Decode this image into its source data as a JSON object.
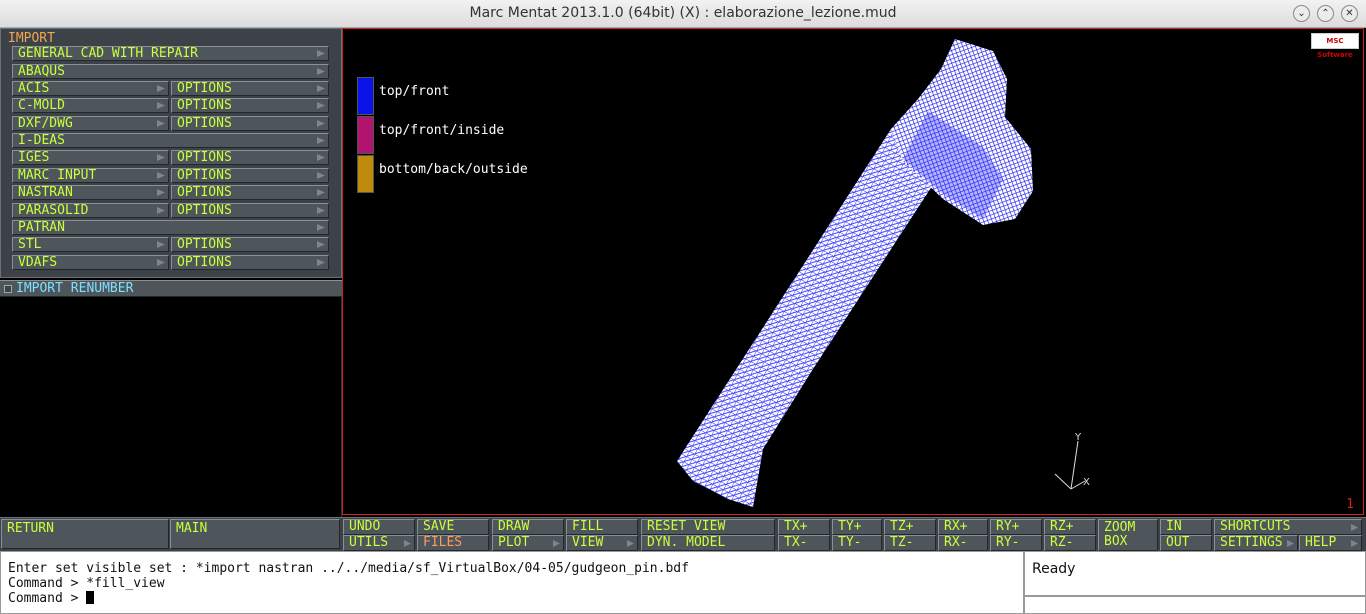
{
  "window": {
    "title": "Marc Mentat 2013.1.0 (64bit) (X) : elaborazione_lezione.mud",
    "controls": [
      "⌄",
      "⌃",
      "✕"
    ]
  },
  "import_menu": {
    "title": "IMPORT",
    "general_cad": "GENERAL CAD WITH REPAIR",
    "abaqus": "ABAQUS",
    "acis": "ACIS",
    "cmold": "C-MOLD",
    "dxf": "DXF/DWG",
    "ideas": "I-DEAS",
    "iges": "IGES",
    "marc_input": "MARC INPUT",
    "nastran": "NASTRAN",
    "parasolid": "PARASOLID",
    "patran": "PATRAN",
    "stl": "STL",
    "vdafs": "VDAFS",
    "options": "OPTIONS"
  },
  "renumber": {
    "label": "IMPORT RENUMBER"
  },
  "nav": {
    "return": "RETURN",
    "main": "MAIN"
  },
  "viewport": {
    "logo": "MSC Software",
    "legend": [
      {
        "label": "top/front",
        "color": "#0a14e6"
      },
      {
        "label": "top/front/inside",
        "color": "#b0146e"
      },
      {
        "label": "bottom/back/outside",
        "color": "#c08a0a"
      }
    ],
    "axes": {
      "y": "Y",
      "x": "X"
    },
    "view_number": "1",
    "mesh_color": "#2a2aff"
  },
  "toolbar": {
    "undo": "UNDO",
    "utils": "UTILS",
    "save": "SAVE",
    "files": "FILES",
    "draw": "DRAW",
    "plot": "PLOT",
    "fill": "FILL",
    "view": "VIEW",
    "reset_view": "RESET VIEW",
    "dyn_model": "DYN. MODEL",
    "txp": "TX+",
    "txm": "TX-",
    "typ": "TY+",
    "tym": "TY-",
    "tzp": "TZ+",
    "tzm": "TZ-",
    "rxp": "RX+",
    "rxm": "RX-",
    "ryp": "RY+",
    "rym": "RY-",
    "rzp": "RZ+",
    "rzm": "RZ-",
    "zoom_box": "ZOOM\nBOX",
    "in": "IN",
    "out": "OUT",
    "shortcuts": "SHORTCUTS",
    "settings": "SETTINGS",
    "help": "HELP"
  },
  "console": {
    "line1": "Enter set visible set : *import nastran ../../media/sf_VirtualBox/04-05/gudgeon_pin.bdf",
    "line2": "Command > *fill_view",
    "line3": "Command > "
  },
  "status": {
    "text": "Ready"
  }
}
